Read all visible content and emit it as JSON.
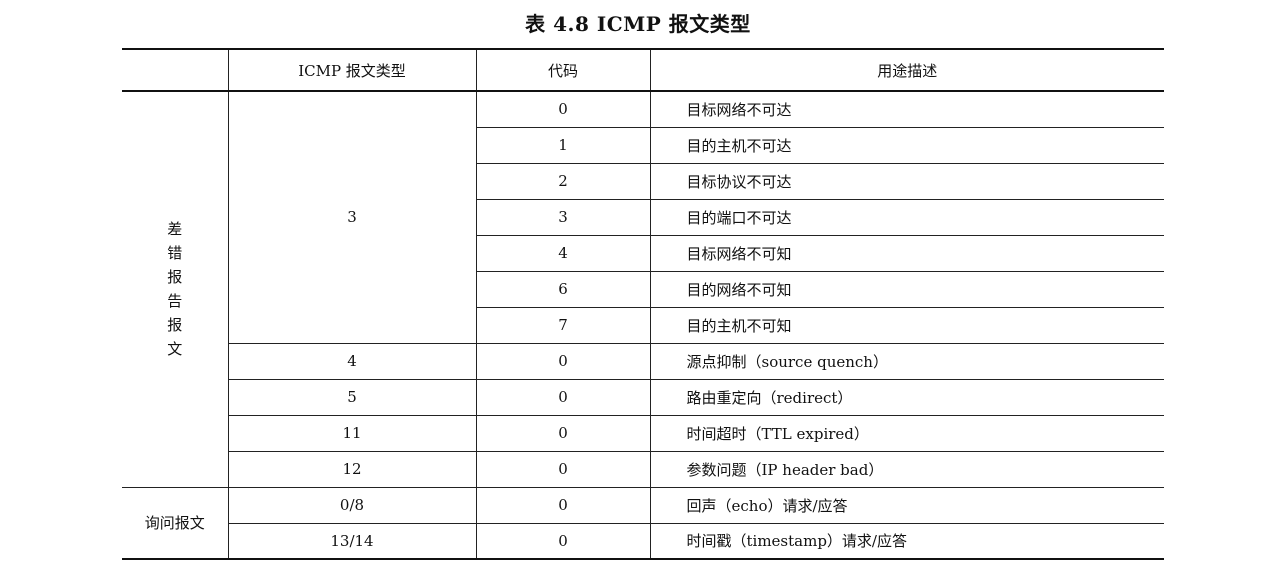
{
  "title": "表 4.8    ICMP 报文类型",
  "headers": {
    "category": "",
    "type": "ICMP 报文类型",
    "code": "代码",
    "description": "用途描述"
  },
  "groups": {
    "error": {
      "label_chars": [
        "差",
        "错",
        "报",
        "告",
        "报",
        "文"
      ]
    },
    "query": {
      "label": "询问报文"
    }
  },
  "rows": [
    {
      "type": "3",
      "code": "0",
      "desc": "目标网络不可达"
    },
    {
      "type": "",
      "code": "1",
      "desc": "目的主机不可达"
    },
    {
      "type": "",
      "code": "2",
      "desc": "目标协议不可达"
    },
    {
      "type": "",
      "code": "3",
      "desc": "目的端口不可达"
    },
    {
      "type": "",
      "code": "4",
      "desc": "目标网络不可知"
    },
    {
      "type": "",
      "code": "6",
      "desc": "目的网络不可知"
    },
    {
      "type": "",
      "code": "7",
      "desc": "目的主机不可知"
    },
    {
      "type": "4",
      "code": "0",
      "desc": "源点抑制（source quench）"
    },
    {
      "type": "5",
      "code": "0",
      "desc": "路由重定向（redirect）"
    },
    {
      "type": "11",
      "code": "0",
      "desc": "时间超时（TTL expired）"
    },
    {
      "type": "12",
      "code": "0",
      "desc": "参数问题（IP header bad）"
    },
    {
      "type": "0/8",
      "code": "0",
      "desc": "回声（echo）请求/应答"
    },
    {
      "type": "13/14",
      "code": "0",
      "desc": "时间戳（timestamp）请求/应答"
    }
  ]
}
